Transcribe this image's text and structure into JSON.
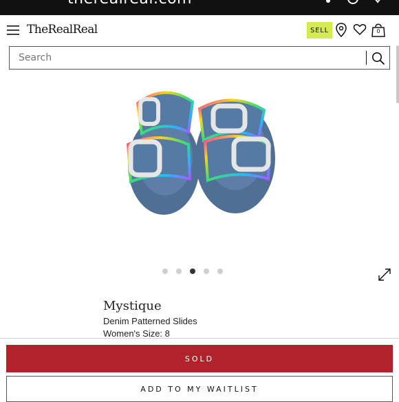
{
  "browser": {
    "domain": "therealreal.com"
  },
  "header": {
    "logo": "TheRealReal",
    "sell_label": "SELL",
    "bag_count": "0",
    "icons": [
      "menu-icon",
      "location-pin-icon",
      "heart-icon",
      "shopping-bag-icon"
    ]
  },
  "search": {
    "placeholder": "Search",
    "value": ""
  },
  "carousel": {
    "total": 5,
    "active": 3
  },
  "product": {
    "brand": "Mystique",
    "name": "Denim Patterned Slides",
    "size": "Women's Size: 8"
  },
  "actions": {
    "sold_label": "SOLD",
    "waitlist_label": "ADD TO MY WAITLIST"
  },
  "colors": {
    "sell_bg": "#d4ec4f",
    "sold_bg": "#b0232a",
    "topbar_bg": "#111111",
    "denim": "#4f6f95"
  }
}
